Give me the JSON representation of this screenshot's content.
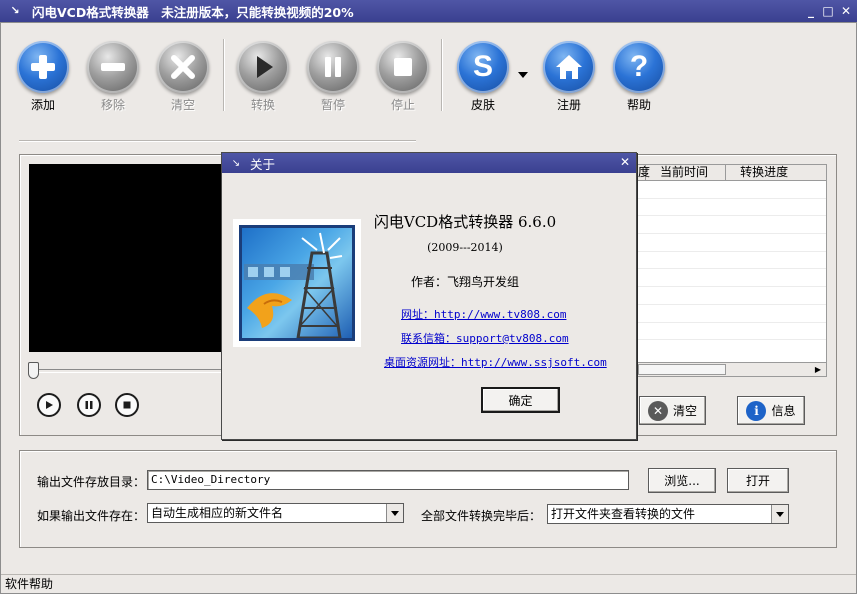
{
  "window": {
    "title": "闪电VCD格式转换器　未注册版本，只能转换视频的20%"
  },
  "toolbar": {
    "add": "添加",
    "remove": "移除",
    "clear": "清空",
    "convert": "转换",
    "pause": "暂停",
    "stop": "停止",
    "skin": "皮肤",
    "register": "注册",
    "help": "帮助"
  },
  "file_table": {
    "columns": [
      "度",
      "当前时间",
      "转换进度"
    ],
    "rows": [],
    "row_count": 9
  },
  "actions": {
    "clear": "清空",
    "info": "信息"
  },
  "output": {
    "dir_label": "输出文件存放目录：",
    "dir_value": "C:\\Video_Directory",
    "browse": "浏览...",
    "open": "打开",
    "exists_label": "如果输出文件存在：",
    "exists_value": "自动生成相应的新文件名",
    "after_label": "全部文件转换完毕后：",
    "after_value": "打开文件夹查看转换的文件"
  },
  "status": {
    "text": "软件帮助"
  },
  "about": {
    "title": "关于",
    "product": "闪电VCD格式转换器 6.6.0",
    "years": "(2009---2014)",
    "author": "作者：飞翔鸟开发组",
    "website": "网址：http://www.tv808.com",
    "email": "联系信箱：support@tv808.com",
    "desktop": "桌面资源网址：http://www.ssjsoft.com",
    "ok": "确定"
  },
  "colors": {
    "title_bar": "#3f4697",
    "link": "#0000cc",
    "accent_blue": "#2b73d6"
  }
}
